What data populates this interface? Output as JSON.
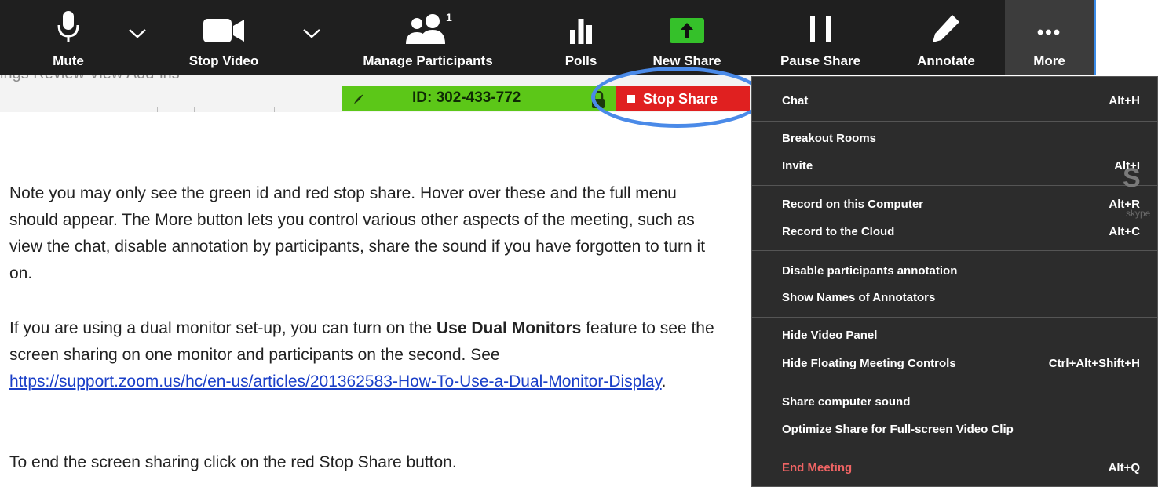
{
  "toolbar": {
    "mute_label": "Mute",
    "stop_video_label": "Stop Video",
    "participants_label": "Manage Participants",
    "participants_count": "1",
    "polls_label": "Polls",
    "new_share_label": "New Share",
    "pause_share_label": "Pause Share",
    "annotate_label": "Annotate",
    "more_label": "More",
    "more_icon": "•••",
    "caret_icon": "chevron-down-icon"
  },
  "background_app": {
    "menu_text": "ings    Review     View     Add-ins"
  },
  "share_bar": {
    "meeting_id": "ID: 302-433-772",
    "stop_share_label": "Stop Share",
    "id_color": "#5cc718",
    "stop_color": "#e02020"
  },
  "body": {
    "para1": "Note you may only see the green id and red stop share. Hover over these and the full menu should appear. The More button lets you control various other aspects of the meeting, such as view the chat, disable annotation by participants, share the sound if you have forgotten to turn it on.",
    "para2_a": "If you are using a dual monitor set-up, you can turn on the ",
    "para2_bold": "Use Dual Monitors",
    "para2_b": " feature to see the screen sharing on one monitor and participants on the second. See ",
    "para2_link": "https://support.zoom.us/hc/en-us/articles/201362583-How-To-Use-a-Dual-Monitor-Display",
    "para2_c": ".",
    "para3": "To end the screen sharing click on the red Stop Share button."
  },
  "menu": {
    "chat": {
      "label": "Chat",
      "shortcut": "Alt+H"
    },
    "breakout": {
      "label": "Breakout Rooms"
    },
    "invite": {
      "label": "Invite",
      "shortcut": "Alt+I"
    },
    "record_computer": {
      "label": "Record on this Computer",
      "shortcut": "Alt+R"
    },
    "record_cloud": {
      "label": "Record to the Cloud",
      "shortcut": "Alt+C"
    },
    "disable_annotation": {
      "label": "Disable participants annotation"
    },
    "show_annotators": {
      "label": "Show Names of Annotators"
    },
    "hide_video": {
      "label": "Hide Video Panel"
    },
    "hide_controls": {
      "label": "Hide Floating Meeting Controls",
      "shortcut": "Ctrl+Alt+Shift+H"
    },
    "share_sound": {
      "label": "Share computer sound"
    },
    "optimize": {
      "label": "Optimize Share for Full-screen Video Clip"
    },
    "end_meeting": {
      "label": "End Meeting",
      "shortcut": "Alt+Q"
    }
  },
  "skype_ghost": {
    "letter": "S",
    "text": "skype"
  }
}
